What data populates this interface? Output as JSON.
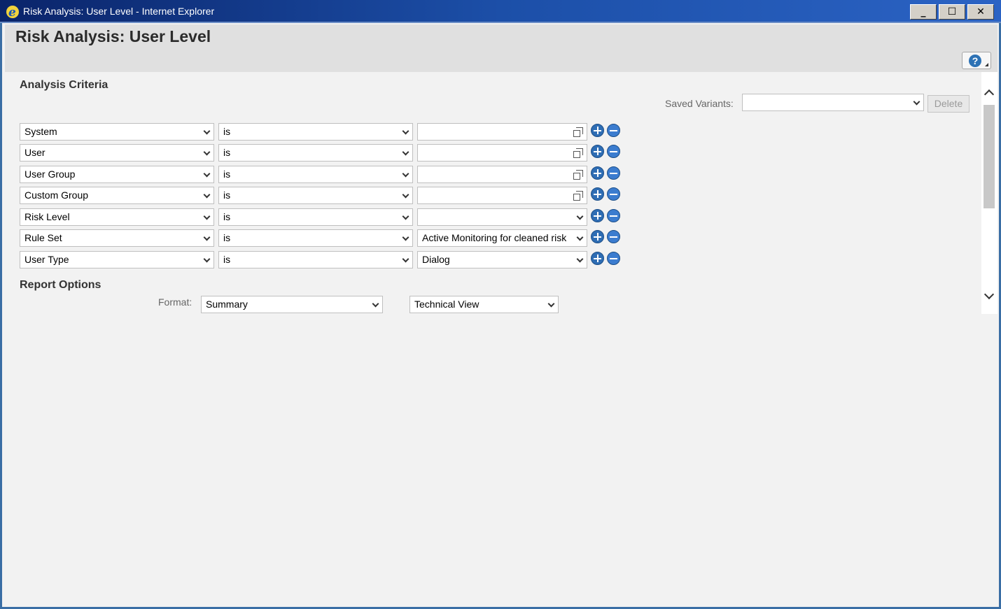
{
  "window": {
    "title": "Risk Analysis: User Level - Internet Explorer",
    "controls": {
      "minimize": "_",
      "maximize": "☐",
      "close": "✕"
    }
  },
  "page": {
    "title": "Risk Analysis: User Level",
    "help_icon": "question-icon"
  },
  "analysis_criteria": {
    "heading": "Analysis Criteria",
    "saved_variants_label": "Saved Variants:",
    "saved_variants_value": "",
    "delete_label": "Delete",
    "rows": [
      {
        "field": "System",
        "operator": "is",
        "value": "",
        "value_type": "picker"
      },
      {
        "field": "User",
        "operator": "is",
        "value": "",
        "value_type": "picker"
      },
      {
        "field": "User Group",
        "operator": "is",
        "value": "",
        "value_type": "picker"
      },
      {
        "field": "Custom Group",
        "operator": "is",
        "value": "",
        "value_type": "picker"
      },
      {
        "field": "Risk Level",
        "operator": "is",
        "value": "",
        "value_type": "dropdown"
      },
      {
        "field": "Rule Set",
        "operator": "is",
        "value": "Active Monitoring for cleaned risk",
        "value_type": "dropdown"
      },
      {
        "field": "User Type",
        "operator": "is",
        "value": "Dialog",
        "value_type": "dropdown"
      }
    ]
  },
  "report_options": {
    "heading": "Report Options",
    "format_label": "Format:",
    "format_value": "Summary",
    "view_value": "Technical View"
  },
  "colors": {
    "titlebar_start": "#0a246a",
    "titlebar_end": "#2b63c4",
    "accent_button": "#2e6db4",
    "background": "#f2f2f2"
  }
}
